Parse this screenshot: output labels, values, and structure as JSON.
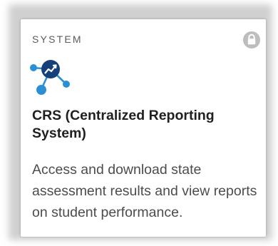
{
  "card": {
    "category": "SYSTEM",
    "title": "CRS (Centralized Reporting System)",
    "description": "Access and download state assessment results and view reports on student performance.",
    "icon": "crs-network-trend-icon",
    "status_icon": "lock-icon"
  },
  "colors": {
    "icon_navy": "#15407a",
    "icon_blue": "#2b8fd6",
    "lock_gray": "#bdbdbd",
    "title_text": "#202020",
    "body_text": "#4c4c4c",
    "category_text": "#5b5b5b"
  }
}
